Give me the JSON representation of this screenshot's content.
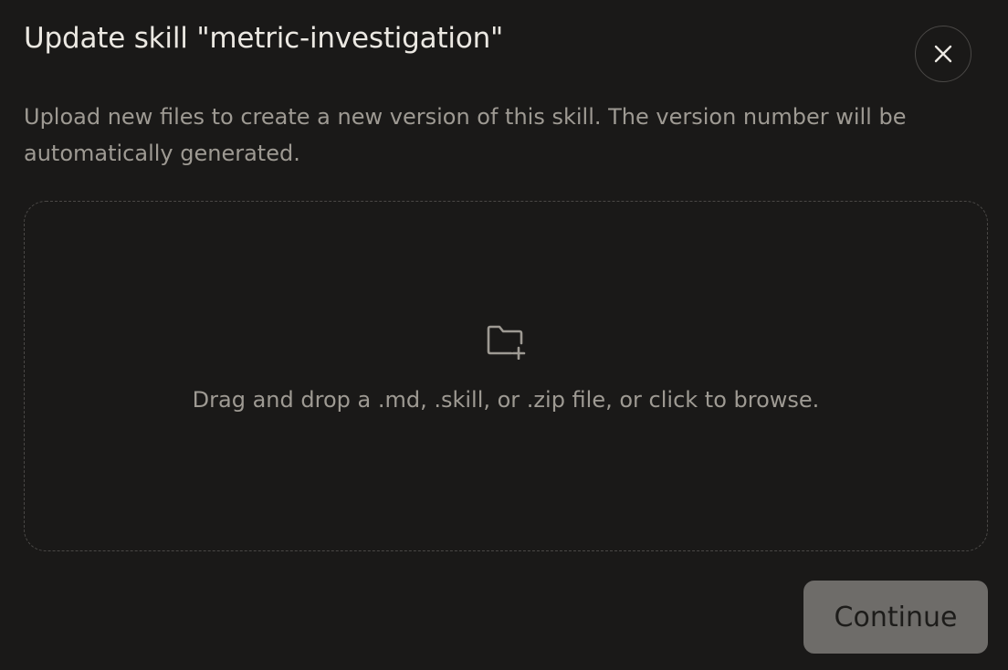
{
  "dialog": {
    "title": "Update skill \"metric-investigation\"",
    "description": "Upload new files to create a new version of this skill. The version number will be automatically generated.",
    "close_icon": "close-icon"
  },
  "dropzone": {
    "icon": "folder-plus-icon",
    "text": "Drag and drop a .md, .skill, or .zip file, or click to browse."
  },
  "actions": {
    "continue_label": "Continue"
  },
  "colors": {
    "background": "#1a1918",
    "title_text": "#ebe8e2",
    "muted_text": "#9e9a93",
    "border": "#4a4846",
    "button_disabled_bg": "#6e6c69"
  }
}
